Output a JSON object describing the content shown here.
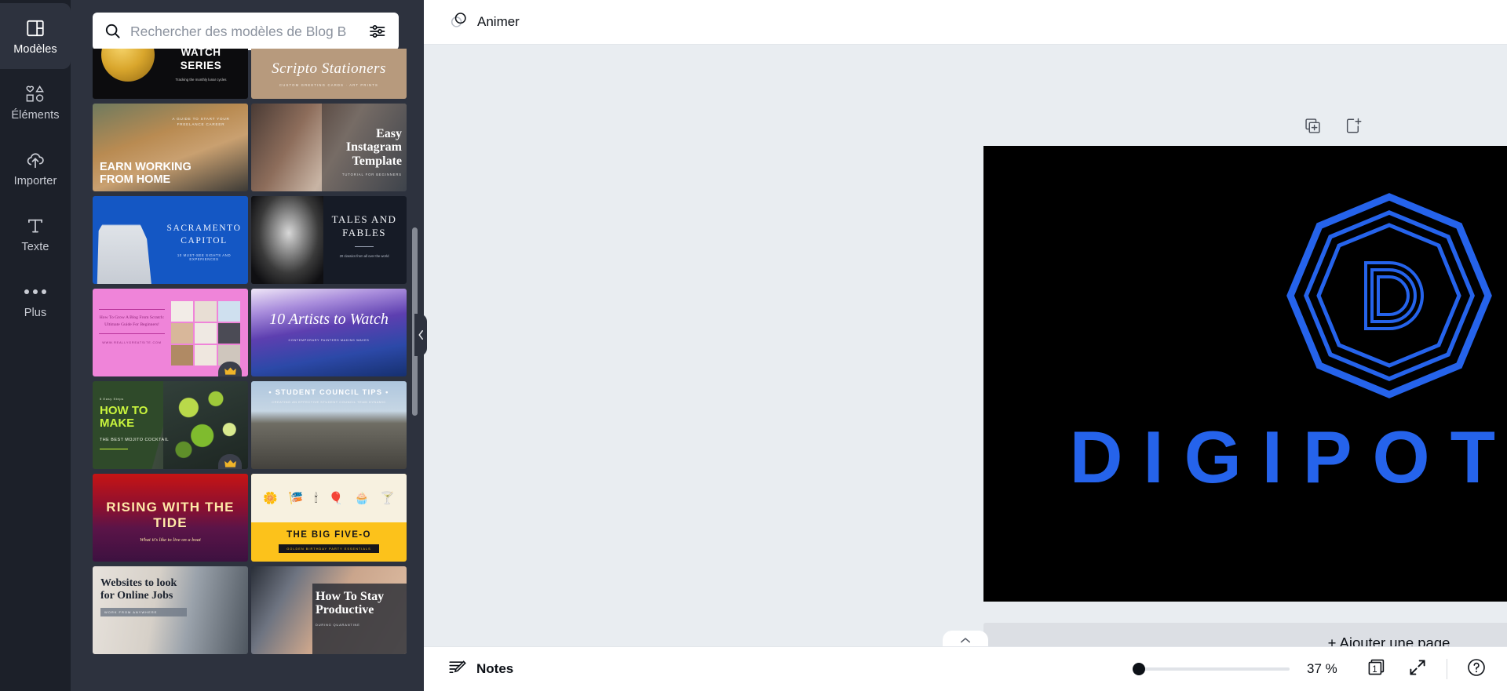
{
  "rail": {
    "items": [
      {
        "label": "Modèles",
        "icon": "templates-icon",
        "active": true
      },
      {
        "label": "Éléments",
        "icon": "elements-icon",
        "active": false
      },
      {
        "label": "Importer",
        "icon": "upload-cloud-icon",
        "active": false
      },
      {
        "label": "Texte",
        "icon": "text-icon",
        "active": false
      },
      {
        "label": "Plus",
        "icon": "more-dots-icon",
        "active": false
      }
    ]
  },
  "search": {
    "placeholder": "Rechercher des modèles de Blog B",
    "value": "",
    "icon": "search-icon",
    "filter_icon": "filter-sliders-icon"
  },
  "templates": [
    {
      "title": "MOON WATCH SERIES",
      "subtitle": "Tracking the monthly lunar cycles",
      "style": "moon",
      "premium": false
    },
    {
      "title": "Scripto Stationers",
      "subtitle": "CUSTOM GREETING CARDS · ART PRINTS",
      "style": "scripto",
      "premium": false
    },
    {
      "title": "EARN WORKING FROM HOME",
      "subtitle": "A GUIDE TO START YOUR FREELANCE CAREER",
      "style": "earn",
      "premium": false
    },
    {
      "title": "Easy Instagram Template",
      "subtitle": "TUTORIAL FOR BEGINNERS",
      "style": "instagram",
      "premium": false
    },
    {
      "title": "SACRAMENTO CAPITOL",
      "subtitle": "10 MUST-SEE SIGHTS AND EXPERIENCES",
      "style": "sacramento",
      "premium": false
    },
    {
      "title": "TALES AND FABLES",
      "subtitle": "20 classics from all over the world",
      "style": "tales",
      "premium": false
    },
    {
      "title": "How To Grow A Blog From Scratch: Ultimate Guide For Beginners!",
      "subtitle": "WWW.REALLYGREATSITE.COM",
      "style": "pinkblog",
      "premium": true
    },
    {
      "title": "10 Artists to Watch",
      "subtitle": "CONTEMPORARY PAINTERS MAKING WAVES",
      "style": "artists",
      "premium": false
    },
    {
      "title": "HOW TO MAKE",
      "subtitle": "THE BEST MOJITO COCKTAIL",
      "style": "mojito",
      "premium": true
    },
    {
      "title": "• STUDENT COUNCIL TIPS •",
      "subtitle": "CREATING AN EFFECTIVE STUDENT COUNCIL TEAM DYNAMIC",
      "style": "council",
      "premium": false
    },
    {
      "title": "RISING WITH THE TIDE",
      "subtitle": "What it's like to live on a boat",
      "style": "tide",
      "premium": false
    },
    {
      "title": "THE BIG FIVE-O",
      "subtitle": "GOLDEN BIRTHDAY PARTY ESSENTIALS",
      "style": "bigfive",
      "premium": false
    },
    {
      "title": "Websites to look for Online Jobs",
      "subtitle": "WORK FROM ANYWHERE",
      "style": "websites",
      "premium": false
    },
    {
      "title": "How To Stay Productive",
      "subtitle": "DURING QUARANTINE",
      "style": "productive",
      "premium": false
    }
  ],
  "panel": {
    "collapse_icon": "chevron-left-icon",
    "scrollbar": "panel-scrollbar"
  },
  "topbar": {
    "animate_label": "Animer",
    "animate_icon": "animate-circles-icon"
  },
  "canvas": {
    "duplicate_page_icon": "duplicate-page-icon",
    "add_page_icon": "add-page-icon",
    "comment_icon": "add-comment-icon",
    "add_page_label": "+ Ajouter une page",
    "sheet_handle_icon": "chevron-up-icon",
    "design": {
      "brand_word": "DIGIPOTENS",
      "logo_letter": "D",
      "accent_color": "#2563eb",
      "background_color": "#000000"
    }
  },
  "bottombar": {
    "notes_label": "Notes",
    "notes_icon": "notes-pencil-icon",
    "zoom_value": "37 %",
    "zoom_percent": 37,
    "page_count": "1",
    "pages_icon": "pages-grid-icon",
    "fullscreen_icon": "expand-arrows-icon",
    "help_icon": "help-question-icon"
  }
}
